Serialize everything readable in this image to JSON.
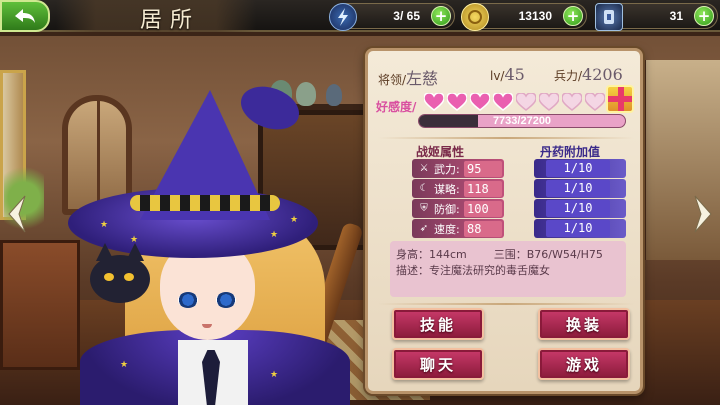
{
  "topbar": {
    "title": "居所",
    "back_icon": "back-arrow-icon",
    "resources": [
      {
        "icon": "lightning-icon",
        "value": "3/ 65"
      },
      {
        "icon": "gold-coin-icon",
        "value": "13130"
      },
      {
        "icon": "gem-card-icon",
        "value": "31"
      }
    ],
    "plus_symbol": "+"
  },
  "panel": {
    "general_label": "将领/",
    "general_name": "左慈",
    "level_label": "lv/",
    "level": "45",
    "troops_label": "兵力/",
    "troops": "4206",
    "affection_label": "好感度/",
    "hearts_filled": 4,
    "hearts_total": 9,
    "affection_value": "7733/27200",
    "affection_progress": 0.284,
    "stats_header": "战姬属性",
    "elixir_header": "丹药附加值",
    "stats": [
      {
        "icon": "sword-icon",
        "label": "武力:",
        "value": "95",
        "elixir": "1/10"
      },
      {
        "icon": "scroll-icon",
        "label": "谋略:",
        "value": "118",
        "elixir": "1/10"
      },
      {
        "icon": "shield-icon",
        "label": "防御:",
        "value": "100",
        "elixir": "1/10"
      },
      {
        "icon": "feather-icon",
        "label": "速度:",
        "value": "88",
        "elixir": "1/10"
      }
    ],
    "info": {
      "height_label": "身高：",
      "height": "144cm",
      "measure_label": "三围：",
      "measure": "B76/W54/H75",
      "desc_label": "描述：",
      "desc": "专注魔法研究的毒舌魔女"
    },
    "buttons": {
      "skill": "技能",
      "outfit": "换装",
      "chat": "聊天",
      "game": "游戏"
    }
  },
  "colors": {
    "accent_pink": "#c93a6a",
    "heart_pink": "#ea5fb0",
    "elixir_purple": "#5a48c8",
    "topbar_green": "#5fbf3a"
  }
}
